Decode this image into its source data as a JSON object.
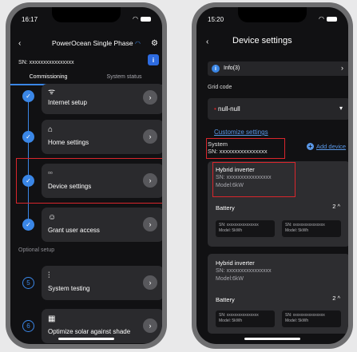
{
  "left_phone": {
    "status_time": "16:17",
    "title": "PowerOcean Single Phase",
    "sn": "SN: xxxxxxxxxxxxxxxx",
    "info_icon": "i",
    "tabs": [
      {
        "label": "Commissioning",
        "active": true
      },
      {
        "label": "System status",
        "active": false
      }
    ],
    "optional_label": "Optional setup",
    "steps": [
      {
        "label": "Internet setup",
        "icon": "wifi-icon",
        "glyph": "ᯤ",
        "node": "✓"
      },
      {
        "label": "Home settings",
        "icon": "home-icon",
        "glyph": "⌂",
        "node": "✓"
      },
      {
        "label": "Device settings",
        "icon": "grid-icon",
        "glyph": "▫▫",
        "node": "✓"
      },
      {
        "label": "Grant user access",
        "icon": "user-icon",
        "glyph": "☺",
        "node": "✓"
      },
      {
        "label": "System testing",
        "icon": "sliders-icon",
        "glyph": "⫶",
        "node": "5"
      },
      {
        "label": "Optimize solar against shade",
        "icon": "solar-panel-icon",
        "glyph": "▦",
        "node": "6"
      }
    ]
  },
  "right_phone": {
    "status_time": "15:20",
    "title": "Device settings",
    "info_label": "Info(3)",
    "info_icon": "i",
    "grid_code_label": "Grid code",
    "grid_code_required": "•",
    "grid_code_value": "null-null",
    "customize_label": "Customize settings",
    "system_label": "System",
    "system_sn": "SN: xxxxxxxxxxxxxxxx",
    "add_device_label": "Add device",
    "devices": [
      {
        "name": "Hybrid inverter",
        "sn": "SN: xxxxxxxxxxxxxxxx",
        "model": "Model:6kW",
        "battery_label": "Battery",
        "battery_count": "2 ^",
        "batteries": [
          {
            "sn": "SN: xxxxxxxxxxxxxxxx",
            "model": "Model: 5kWh"
          },
          {
            "sn": "SN: xxxxxxxxxxxxxxxx",
            "model": "Model: 5kWh"
          }
        ]
      },
      {
        "name": "Hybrid inverter",
        "sn": "SN: xxxxxxxxxxxxxxxx",
        "model": "Model:6kW",
        "battery_label": "Battery",
        "battery_count": "2 ^",
        "batteries": [
          {
            "sn": "SN: xxxxxxxxxxxxxxxx",
            "model": "Model: 5kWh"
          },
          {
            "sn": "SN: xxxxxxxxxxxxxxxx",
            "model": "Model: 5kWh"
          }
        ]
      }
    ]
  },
  "colors": {
    "accent": "#3a86e6",
    "highlight": "#d9262c",
    "card": "#2a2a2d",
    "background": "#111113"
  }
}
